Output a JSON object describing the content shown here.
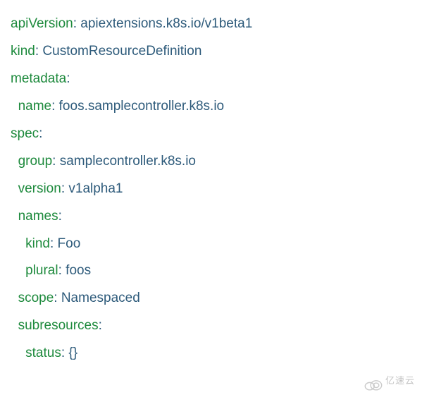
{
  "yaml": {
    "apiVersion": {
      "key": "apiVersion",
      "value": "apiextensions.k8s.io/v1beta1"
    },
    "kind": {
      "key": "kind",
      "value": "CustomResourceDefinition"
    },
    "metadata": {
      "key": "metadata",
      "colon": ":"
    },
    "metadata_name": {
      "key": "name",
      "value": "foos.samplecontroller.k8s.io"
    },
    "spec": {
      "key": "spec",
      "colon": ":"
    },
    "spec_group": {
      "key": "group",
      "value": "samplecontroller.k8s.io"
    },
    "spec_version": {
      "key": "version",
      "value": "v1alpha1"
    },
    "spec_names": {
      "key": "names",
      "colon": ":"
    },
    "spec_names_kind": {
      "key": "kind",
      "value": "Foo"
    },
    "spec_names_plural": {
      "key": "plural",
      "value": "foos"
    },
    "spec_scope": {
      "key": "scope",
      "value": "Namespaced"
    },
    "spec_subresources": {
      "key": "subresources",
      "colon": ":"
    },
    "spec_subresources_status": {
      "key": "status",
      "value": "{}"
    }
  },
  "watermark": {
    "text": "亿速云"
  }
}
